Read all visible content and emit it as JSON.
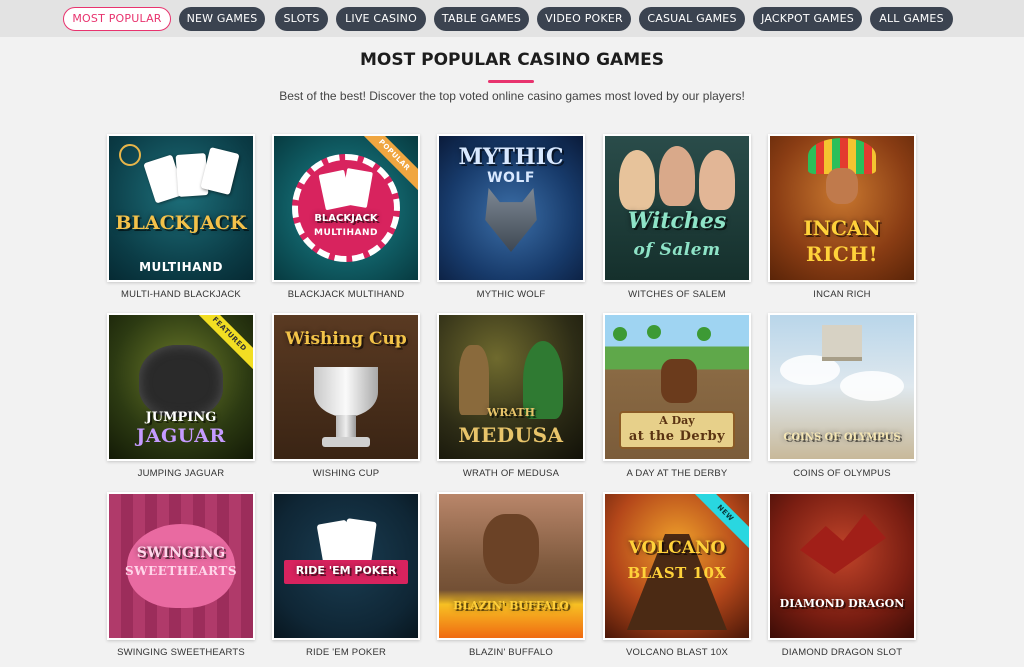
{
  "nav": {
    "tabs": [
      {
        "label": "MOST POPULAR",
        "active": true
      },
      {
        "label": "NEW GAMES"
      },
      {
        "label": "SLOTS"
      },
      {
        "label": "LIVE CASINO"
      },
      {
        "label": "TABLE GAMES"
      },
      {
        "label": "VIDEO POKER"
      },
      {
        "label": "CASUAL GAMES"
      },
      {
        "label": "JACKPOT GAMES"
      },
      {
        "label": "ALL GAMES"
      }
    ]
  },
  "page": {
    "heading": "MOST POPULAR CASINO GAMES",
    "subtitle": "Best of the best! Discover the top voted online casino games most loved by our players!"
  },
  "colors": {
    "accent": "#e8336e",
    "pill": "#3b4350",
    "popular_ribbon": "#f0a640",
    "featured_ribbon": "#f2de23",
    "new_ribbon": "#29d7e0"
  },
  "games": [
    {
      "name": "MULTI-HAND BLACKJACK",
      "art_title": "BLACKJACK",
      "art_sub": "MULTIHAND"
    },
    {
      "name": "BLACKJACK MULTIHAND",
      "art_title": "BLACKJACK",
      "art_sub": "MULTIHAND",
      "badge": "POPULAR"
    },
    {
      "name": "MYTHIC WOLF",
      "art_title": "MYTHIC",
      "art_sub": "WOLF"
    },
    {
      "name": "WITCHES OF SALEM",
      "art_title": "Witches",
      "art_sub": "of Salem"
    },
    {
      "name": "INCAN RICH",
      "art_title": "INCAN",
      "art_sub": "RICH!"
    },
    {
      "name": "JUMPING JAGUAR",
      "art_title": "JUMPING",
      "art_sub": "JAGUAR",
      "badge": "FEATURED"
    },
    {
      "name": "WISHING CUP",
      "art_title": "Wishing Cup",
      "art_sub": ""
    },
    {
      "name": "WRATH OF MEDUSA",
      "art_title": "WRATH",
      "art_sub": "MEDUSA"
    },
    {
      "name": "A DAY AT THE DERBY",
      "art_title": "A Day",
      "art_sub": "at the Derby"
    },
    {
      "name": "COINS OF OLYMPUS",
      "art_title": "COINS OF OLYMPUS",
      "art_sub": ""
    },
    {
      "name": "SWINGING SWEETHEARTS",
      "art_title": "SWINGING",
      "art_sub": "SWEETHEARTS"
    },
    {
      "name": "RIDE 'EM POKER",
      "art_title": "RIDE 'EM POKER",
      "art_sub": ""
    },
    {
      "name": "BLAZIN' BUFFALO",
      "art_title": "BLAZIN' BUFFALO",
      "art_sub": ""
    },
    {
      "name": "VOLCANO BLAST 10X",
      "art_title": "VOLCANO",
      "art_sub": "BLAST 10X",
      "badge": "NEW"
    },
    {
      "name": "DIAMOND DRAGON SLOT",
      "art_title": "DIAMOND DRAGON",
      "art_sub": ""
    }
  ]
}
